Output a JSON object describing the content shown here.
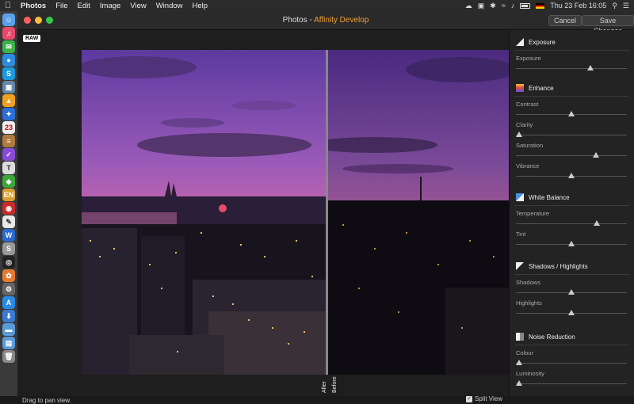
{
  "menubar": {
    "app_name": "Photos",
    "menus": [
      "File",
      "Edit",
      "Image",
      "View",
      "Window",
      "Help"
    ],
    "clock": "Thu 23 Feb 16:05"
  },
  "window": {
    "title_prefix": "Photos - ",
    "title_accent": "Affinity Develop",
    "cancel_label": "Cancel",
    "save_label": "Save Changes"
  },
  "canvas": {
    "raw_badge": "RAW",
    "after_label": "After",
    "before_label": "Before",
    "status": "Drag to pan view.",
    "split_view_label": "Split View",
    "split_view_checked": true
  },
  "panel": {
    "sections": [
      {
        "title": "Exposure",
        "icon": "exposure-icon",
        "sliders": [
          {
            "label": "Exposure",
            "value": 0.67
          }
        ]
      },
      {
        "title": "Enhance",
        "icon": "enhance-icon",
        "sliders": [
          {
            "label": "Contrast",
            "value": 0.5
          },
          {
            "label": "Clarity",
            "value": 0.0
          },
          {
            "label": "Saturation",
            "value": 0.72
          },
          {
            "label": "Vibrance",
            "value": 0.5
          }
        ]
      },
      {
        "title": "White Balance",
        "icon": "white-balance-icon",
        "sliders": [
          {
            "label": "Temperature",
            "value": 0.73
          },
          {
            "label": "Tint",
            "value": 0.5
          }
        ]
      },
      {
        "title": "Shadows / Highlights",
        "icon": "shadows-highlights-icon",
        "sliders": [
          {
            "label": "Shadows",
            "value": 0.5
          },
          {
            "label": "Highlights",
            "value": 0.5
          }
        ]
      },
      {
        "title": "Noise Reduction",
        "icon": "noise-reduction-icon",
        "sliders": [
          {
            "label": "Colour",
            "value": 0.0
          },
          {
            "label": "Luminosity",
            "value": 0.0
          }
        ]
      }
    ]
  }
}
